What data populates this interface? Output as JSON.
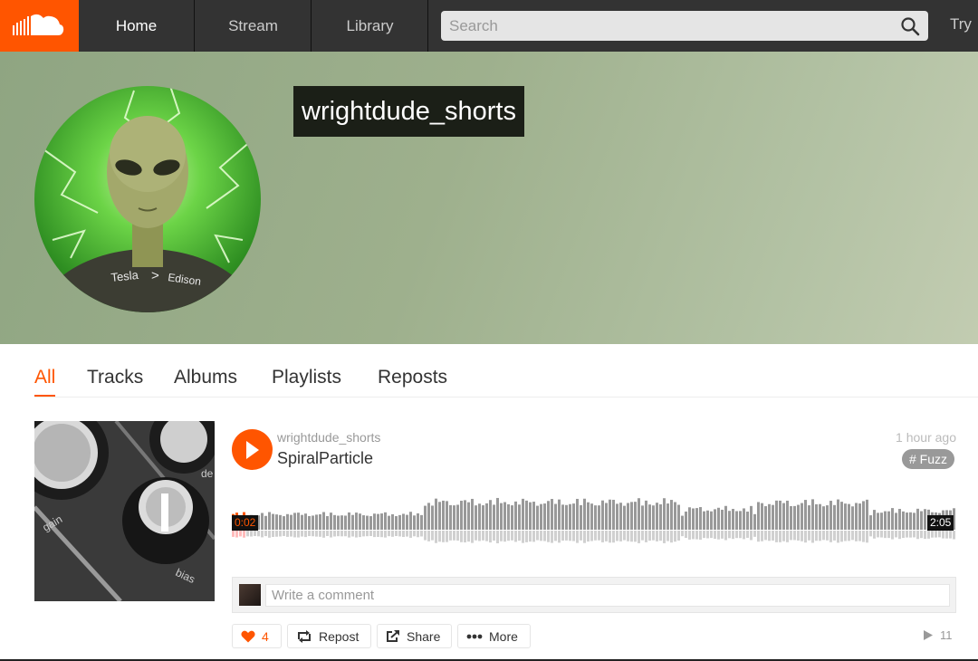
{
  "nav": {
    "logo_icon": "soundcloud-cloud-icon",
    "home": "Home",
    "stream": "Stream",
    "library": "Library",
    "search_placeholder": "Search",
    "search_icon": "search-icon",
    "try_label": "Try"
  },
  "profile": {
    "username": "wrightdude_shorts",
    "avatar_text_1": "Tesla",
    "avatar_text_2": "Edison"
  },
  "tabs": [
    "All",
    "Tracks",
    "Albums",
    "Playlists",
    "Reposts"
  ],
  "active_tab": "All",
  "track": {
    "user": "wrightdude_shorts",
    "title": "SpiralParticle",
    "posted": "1 hour ago",
    "tag": "# Fuzz",
    "artwork_labels": [
      "gain",
      "bias",
      "de"
    ],
    "current_time": "0:02",
    "duration": "2:05",
    "progress_fraction": 0.016,
    "comment_placeholder": "Write a comment",
    "likes": "4",
    "repost_label": "Repost",
    "share_label": "Share",
    "more_label": "More",
    "plays": "11"
  },
  "colors": {
    "accent": "#ff5500",
    "topbar": "#333333",
    "waveform": "#999999"
  }
}
